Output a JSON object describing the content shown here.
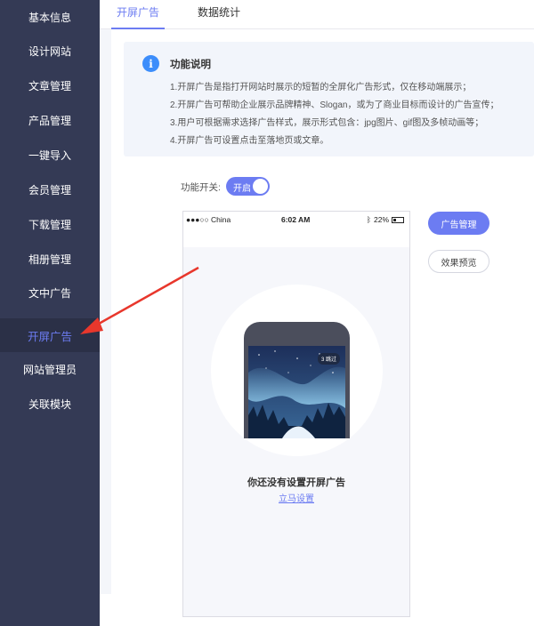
{
  "sidebar": {
    "items": [
      {
        "label": "基本信息"
      },
      {
        "label": "设计网站"
      },
      {
        "label": "文章管理"
      },
      {
        "label": "产品管理"
      },
      {
        "label": "一键导入"
      },
      {
        "label": "会员管理"
      },
      {
        "label": "下载管理"
      },
      {
        "label": "相册管理"
      },
      {
        "label": "文中广告"
      },
      {
        "label": "开屏广告",
        "active": true
      },
      {
        "label": "网站管理员"
      },
      {
        "label": "关联模块"
      }
    ]
  },
  "tabs": [
    {
      "label": "开屏广告",
      "active": true
    },
    {
      "label": "数据统计"
    }
  ],
  "info": {
    "icon": "info-icon",
    "title": "功能说明",
    "lines": [
      "1.开屏广告是指打开网站时展示的短暂的全屏化广告形式，仅在移动端展示；",
      "2.开屏广告可帮助企业展示品牌精神、Slogan，或为了商业目标而设计的广告宣传；",
      "3.用户可根据需求选择广告样式，展示形式包含：jpg图片、gif图及多帧动画等；",
      "4.开屏广告可设置点击至落地页或文章。"
    ]
  },
  "toggle": {
    "label": "功能开关:",
    "state_text": "开启",
    "on": true
  },
  "phone": {
    "carrier": "●●●○○ China",
    "time": "6:02 AM",
    "battery": "22%",
    "skip_badge": "3 跳过",
    "empty_title": "你还没有设置开屏广告",
    "empty_link": "立马设置"
  },
  "buttons": {
    "ad_manage": "广告管理",
    "preview": "效果预览"
  },
  "colors": {
    "sidebar_bg": "#343a55",
    "accent": "#6c7cf2",
    "annotation_arrow": "#e8372c"
  }
}
